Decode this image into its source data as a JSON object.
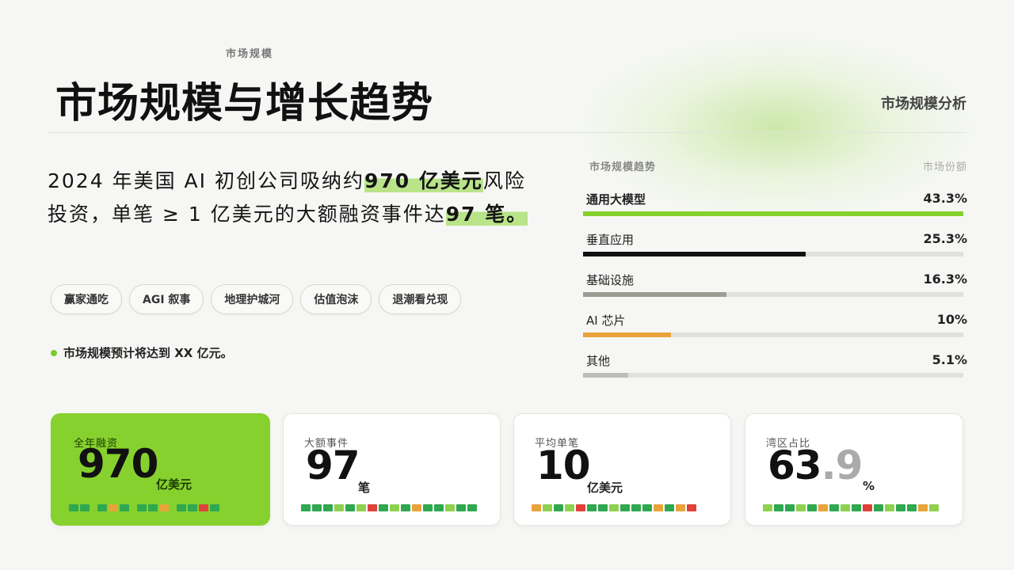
{
  "header": {
    "kicker": "市场规模",
    "title": "市场规模与增长趋势",
    "right_label": "市场规模分析"
  },
  "lede": {
    "part1": "2024 年美国 AI 初创公司吸纳约",
    "highlight1": "970 亿美元",
    "part2": "风险投资，单笔 ≥ 1 亿美元的大额融资事件达",
    "highlight2": "97 笔",
    "part3": "。"
  },
  "tags": [
    "赢家通吃",
    "AGI 叙事",
    "地理护城河",
    "估值泡沫",
    "退潮看兑现"
  ],
  "note": "市场规模预计将达到 XX 亿元。",
  "share_panel": {
    "title": "市场规模趋势",
    "right_title": "市场份额",
    "rows": [
      {
        "label": "通用大模型",
        "value_text": "43.3%",
        "value": 43.3,
        "color": "#86d12e"
      },
      {
        "label": "垂直应用",
        "value_text": "25.3%",
        "value": 25.3,
        "color": "#111111"
      },
      {
        "label": "基础设施",
        "value_text": "16.3%",
        "value": 16.3,
        "color": "#9a9d94"
      },
      {
        "label": "AI 芯片",
        "value_text": "10%",
        "value": 10,
        "color": "#e9a33b"
      },
      {
        "label": "其他",
        "value_text": "5.1%",
        "value": 5.1,
        "color": "#bdbdb8"
      }
    ]
  },
  "stats": [
    {
      "label": "全年融资",
      "value": "970",
      "unit": "亿美元"
    },
    {
      "label": "大额事件",
      "value": "97",
      "unit": "笔"
    },
    {
      "label": "平均单笔",
      "value": "10",
      "unit": "亿美元"
    },
    {
      "label": "湾区占比",
      "value_main": "63",
      "value_decimal": ".9",
      "unit": "%"
    }
  ],
  "colors": {
    "accent": "#86d12e",
    "dark": "#111111",
    "background": "#f6f7f4"
  }
}
